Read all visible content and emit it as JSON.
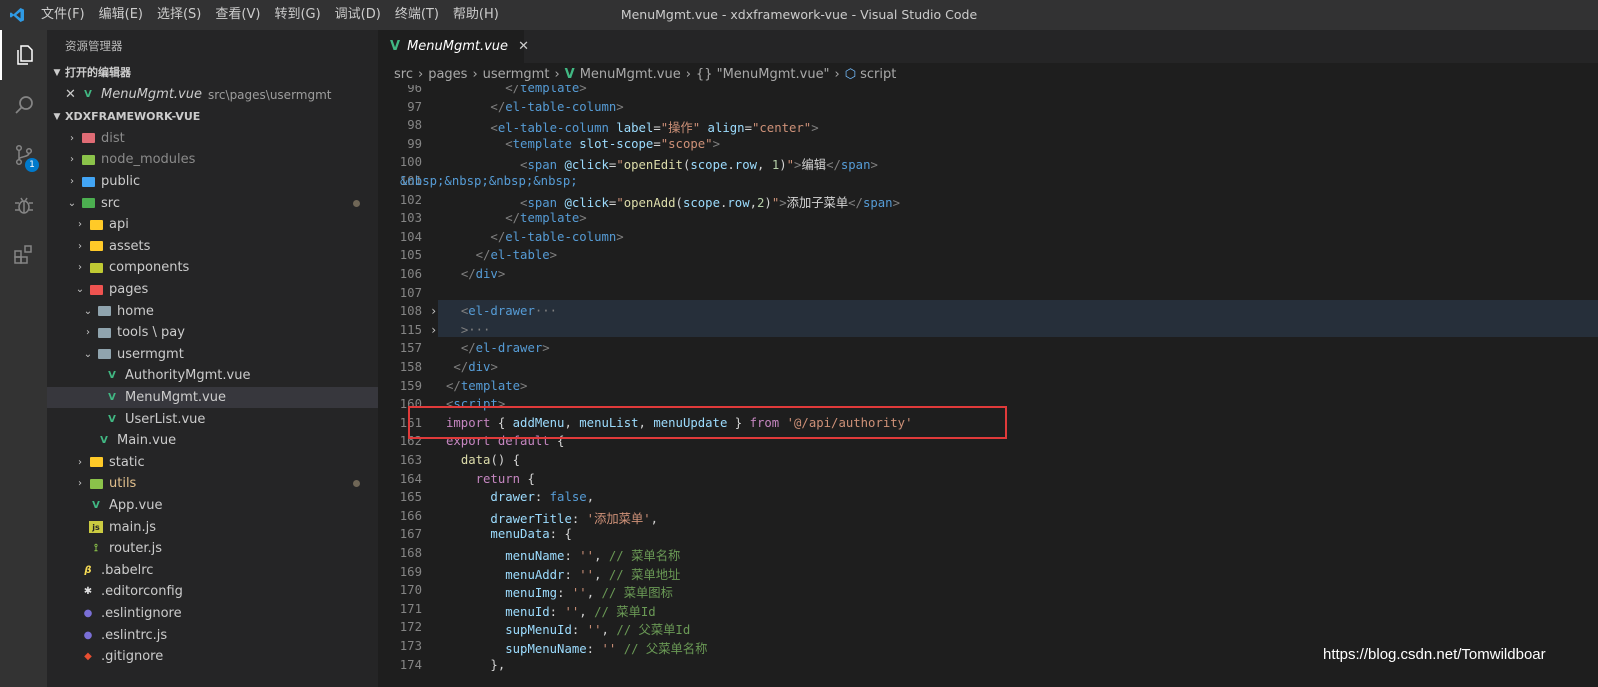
{
  "titlebar": {
    "window_title": "MenuMgmt.vue - xdxframework-vue - Visual Studio Code",
    "menu": [
      "文件(F)",
      "编辑(E)",
      "选择(S)",
      "查看(V)",
      "转到(G)",
      "调试(D)",
      "终端(T)",
      "帮助(H)"
    ]
  },
  "activity": {
    "scm_badge": "1"
  },
  "sidebar": {
    "title": "资源管理器",
    "open_editors_header": "打开的编辑器",
    "open_editor": {
      "name": "MenuMgmt.vue",
      "path": "src\\pages\\usermgmt"
    },
    "project_header": "XDXFRAMEWORK-VUE",
    "tree": [
      {
        "name": "dist",
        "type": "folder",
        "level": 0,
        "expanded": false,
        "color": "#e06c75",
        "dim": true
      },
      {
        "name": "node_modules",
        "type": "folder",
        "level": 0,
        "expanded": false,
        "color": "#8bc34a",
        "dim": true
      },
      {
        "name": "public",
        "type": "folder",
        "level": 0,
        "expanded": false,
        "color": "#42a5f5"
      },
      {
        "name": "src",
        "type": "folder",
        "level": 0,
        "expanded": true,
        "color": "#4caf50",
        "dot": true
      },
      {
        "name": "api",
        "type": "folder",
        "level": 1,
        "expanded": false,
        "color": "#ffca28"
      },
      {
        "name": "assets",
        "type": "folder",
        "level": 1,
        "expanded": false,
        "color": "#ffca28"
      },
      {
        "name": "components",
        "type": "folder",
        "level": 1,
        "expanded": false,
        "color": "#c0ca33"
      },
      {
        "name": "pages",
        "type": "folder",
        "level": 1,
        "expanded": true,
        "color": "#ef5350"
      },
      {
        "name": "home",
        "type": "folder",
        "level": 2,
        "expanded": true,
        "color": "#90a4ae"
      },
      {
        "name": "tools \\ pay",
        "type": "folder",
        "level": 2,
        "expanded": false,
        "color": "#90a4ae"
      },
      {
        "name": "usermgmt",
        "type": "folder",
        "level": 2,
        "expanded": true,
        "color": "#90a4ae"
      },
      {
        "name": "AuthorityMgmt.vue",
        "type": "vue",
        "level": 3
      },
      {
        "name": "MenuMgmt.vue",
        "type": "vue",
        "level": 3,
        "selected": true
      },
      {
        "name": "UserList.vue",
        "type": "vue",
        "level": 3
      },
      {
        "name": "Main.vue",
        "type": "vue",
        "level": 2
      },
      {
        "name": "static",
        "type": "folder",
        "level": 1,
        "expanded": false,
        "color": "#ffca28"
      },
      {
        "name": "utils",
        "type": "folder",
        "level": 1,
        "expanded": false,
        "color": "#8bc34a",
        "dot": true,
        "yellow": true
      },
      {
        "name": "App.vue",
        "type": "vue",
        "level": 1
      },
      {
        "name": "main.js",
        "type": "js",
        "level": 1
      },
      {
        "name": "router.js",
        "type": "router",
        "level": 1
      },
      {
        "name": ".babelrc",
        "type": "babel",
        "level": 0
      },
      {
        "name": ".editorconfig",
        "type": "editorconfig",
        "level": 0
      },
      {
        "name": ".eslintignore",
        "type": "eslint",
        "level": 0
      },
      {
        "name": ".eslintrc.js",
        "type": "eslint",
        "level": 0
      },
      {
        "name": ".gitignore",
        "type": "git",
        "level": 0
      }
    ]
  },
  "editor": {
    "tab_label": "MenuMgmt.vue",
    "breadcrumb": [
      "src",
      "pages",
      "usermgmt",
      "MenuMgmt.vue",
      "{} \"MenuMgmt.vue\"",
      "script"
    ],
    "lines": [
      {
        "n": "96",
        "html": "        <span class=\"t\">&lt;/</span><span class=\"tag\">template</span><span class=\"t\">&gt;</span>"
      },
      {
        "n": "97",
        "html": "      <span class=\"t\">&lt;/</span><span class=\"tag\">el-table-column</span><span class=\"t\">&gt;</span>"
      },
      {
        "n": "98",
        "html": "      <span class=\"t\">&lt;</span><span class=\"tag\">el-table-column</span> <span class=\"at\">label</span>=<span class=\"s\">\"操作\"</span> <span class=\"at\">align</span>=<span class=\"s\">\"center\"</span><span class=\"t\">&gt;</span>"
      },
      {
        "n": "99",
        "html": "        <span class=\"t\">&lt;</span><span class=\"tag\">template</span> <span class=\"at\">slot-scope</span>=<span class=\"s\">\"scope\"</span><span class=\"t\">&gt;</span>"
      },
      {
        "n": "100",
        "html": "          <span class=\"t\">&lt;</span><span class=\"tag\">span</span> <span class=\"at\">@click</span>=<span class=\"s\">\"</span><span class=\"f\">openEdit</span>(<span class=\"v\">scope</span>.<span class=\"v\">row</span>, <span class=\"n\">1</span>)<span class=\"s\">\"</span><span class=\"t\">&gt;</span>编辑<span class=\"t\">&lt;/</span><span class=\"tag\">span</span><span class=\"t\">&gt;</span>"
      },
      {
        "n": "101",
        "html": "<span class=\"tag\">&amp;nbsp;&amp;nbsp;&amp;nbsp;&amp;nbsp;</span>",
        "offset": -46
      },
      {
        "n": "102",
        "html": "          <span class=\"t\">&lt;</span><span class=\"tag\">span</span> <span class=\"at\">@click</span>=<span class=\"s\">\"</span><span class=\"f\">openAdd</span>(<span class=\"v\">scope</span>.<span class=\"v\">row</span>,<span class=\"n\">2</span>)<span class=\"s\">\"</span><span class=\"t\">&gt;</span>添加子菜单<span class=\"t\">&lt;/</span><span class=\"tag\">span</span><span class=\"t\">&gt;</span>"
      },
      {
        "n": "103",
        "html": "        <span class=\"t\">&lt;/</span><span class=\"tag\">template</span><span class=\"t\">&gt;</span>"
      },
      {
        "n": "104",
        "html": "      <span class=\"t\">&lt;/</span><span class=\"tag\">el-table-column</span><span class=\"t\">&gt;</span>"
      },
      {
        "n": "105",
        "html": "    <span class=\"t\">&lt;/</span><span class=\"tag\">el-table</span><span class=\"t\">&gt;</span>"
      },
      {
        "n": "106",
        "html": "  <span class=\"t\">&lt;/</span><span class=\"tag\">div</span><span class=\"t\">&gt;</span>"
      },
      {
        "n": "107",
        "html": ""
      },
      {
        "n": "108",
        "html": "  <span class=\"t\">&lt;</span><span class=\"tag\">el-drawer</span><span class=\"t\">···</span>",
        "fold": true
      },
      {
        "n": "115",
        "html": "  <span class=\"t\">&gt;···</span>",
        "fold": true
      },
      {
        "n": "157",
        "html": "  <span class=\"t\">&lt;/</span><span class=\"tag\">el-drawer</span><span class=\"t\">&gt;</span>"
      },
      {
        "n": "158",
        "html": " <span class=\"t\">&lt;/</span><span class=\"tag\">div</span><span class=\"t\">&gt;</span>"
      },
      {
        "n": "159",
        "html": "<span class=\"t\">&lt;/</span><span class=\"tag\">template</span><span class=\"t\">&gt;</span>"
      },
      {
        "n": "160",
        "html": "<span class=\"t\">&lt;</span><span class=\"tag\">script</span><span class=\"t\">&gt;</span>"
      },
      {
        "n": "161",
        "html": "<span class=\"k\">import</span> { <span class=\"v\">addMenu</span>, <span class=\"v\">menuList</span>, <span class=\"v\">menuUpdate</span> } <span class=\"k\">from</span> <span class=\"s\">'@/api/authority'</span>"
      },
      {
        "n": "162",
        "html": "<span class=\"k\">export</span> <span class=\"k\">default</span> {"
      },
      {
        "n": "163",
        "html": "  <span class=\"f\">data</span>() {"
      },
      {
        "n": "164",
        "html": "    <span class=\"k\">return</span> {"
      },
      {
        "n": "165",
        "html": "      <span class=\"v\">drawer</span>: <span class=\"b\">false</span>,"
      },
      {
        "n": "166",
        "html": "      <span class=\"v\">drawerTitle</span>: <span class=\"s\">'添加菜单'</span>,"
      },
      {
        "n": "167",
        "html": "      <span class=\"v\">menuData</span>: {"
      },
      {
        "n": "168",
        "html": "        <span class=\"v\">menuName</span>: <span class=\"s\">''</span>, <span class=\"c\">// 菜单名称</span>"
      },
      {
        "n": "169",
        "html": "        <span class=\"v\">menuAddr</span>: <span class=\"s\">''</span>, <span class=\"c\">// 菜单地址</span>"
      },
      {
        "n": "170",
        "html": "        <span class=\"v\">menuImg</span>: <span class=\"s\">''</span>, <span class=\"c\">// 菜单图标</span>"
      },
      {
        "n": "171",
        "html": "        <span class=\"v\">menuId</span>: <span class=\"s\">''</span>, <span class=\"c\">// 菜单Id</span>"
      },
      {
        "n": "172",
        "html": "        <span class=\"v\">supMenuId</span>: <span class=\"s\">''</span>, <span class=\"c\">// 父菜单Id</span>"
      },
      {
        "n": "173",
        "html": "        <span class=\"v\">supMenuName</span>: <span class=\"s\">''</span> <span class=\"c\">// 父菜单名称</span>"
      },
      {
        "n": "174",
        "html": "      },"
      }
    ]
  },
  "watermark": "https://blog.csdn.net/Tomwildboar"
}
